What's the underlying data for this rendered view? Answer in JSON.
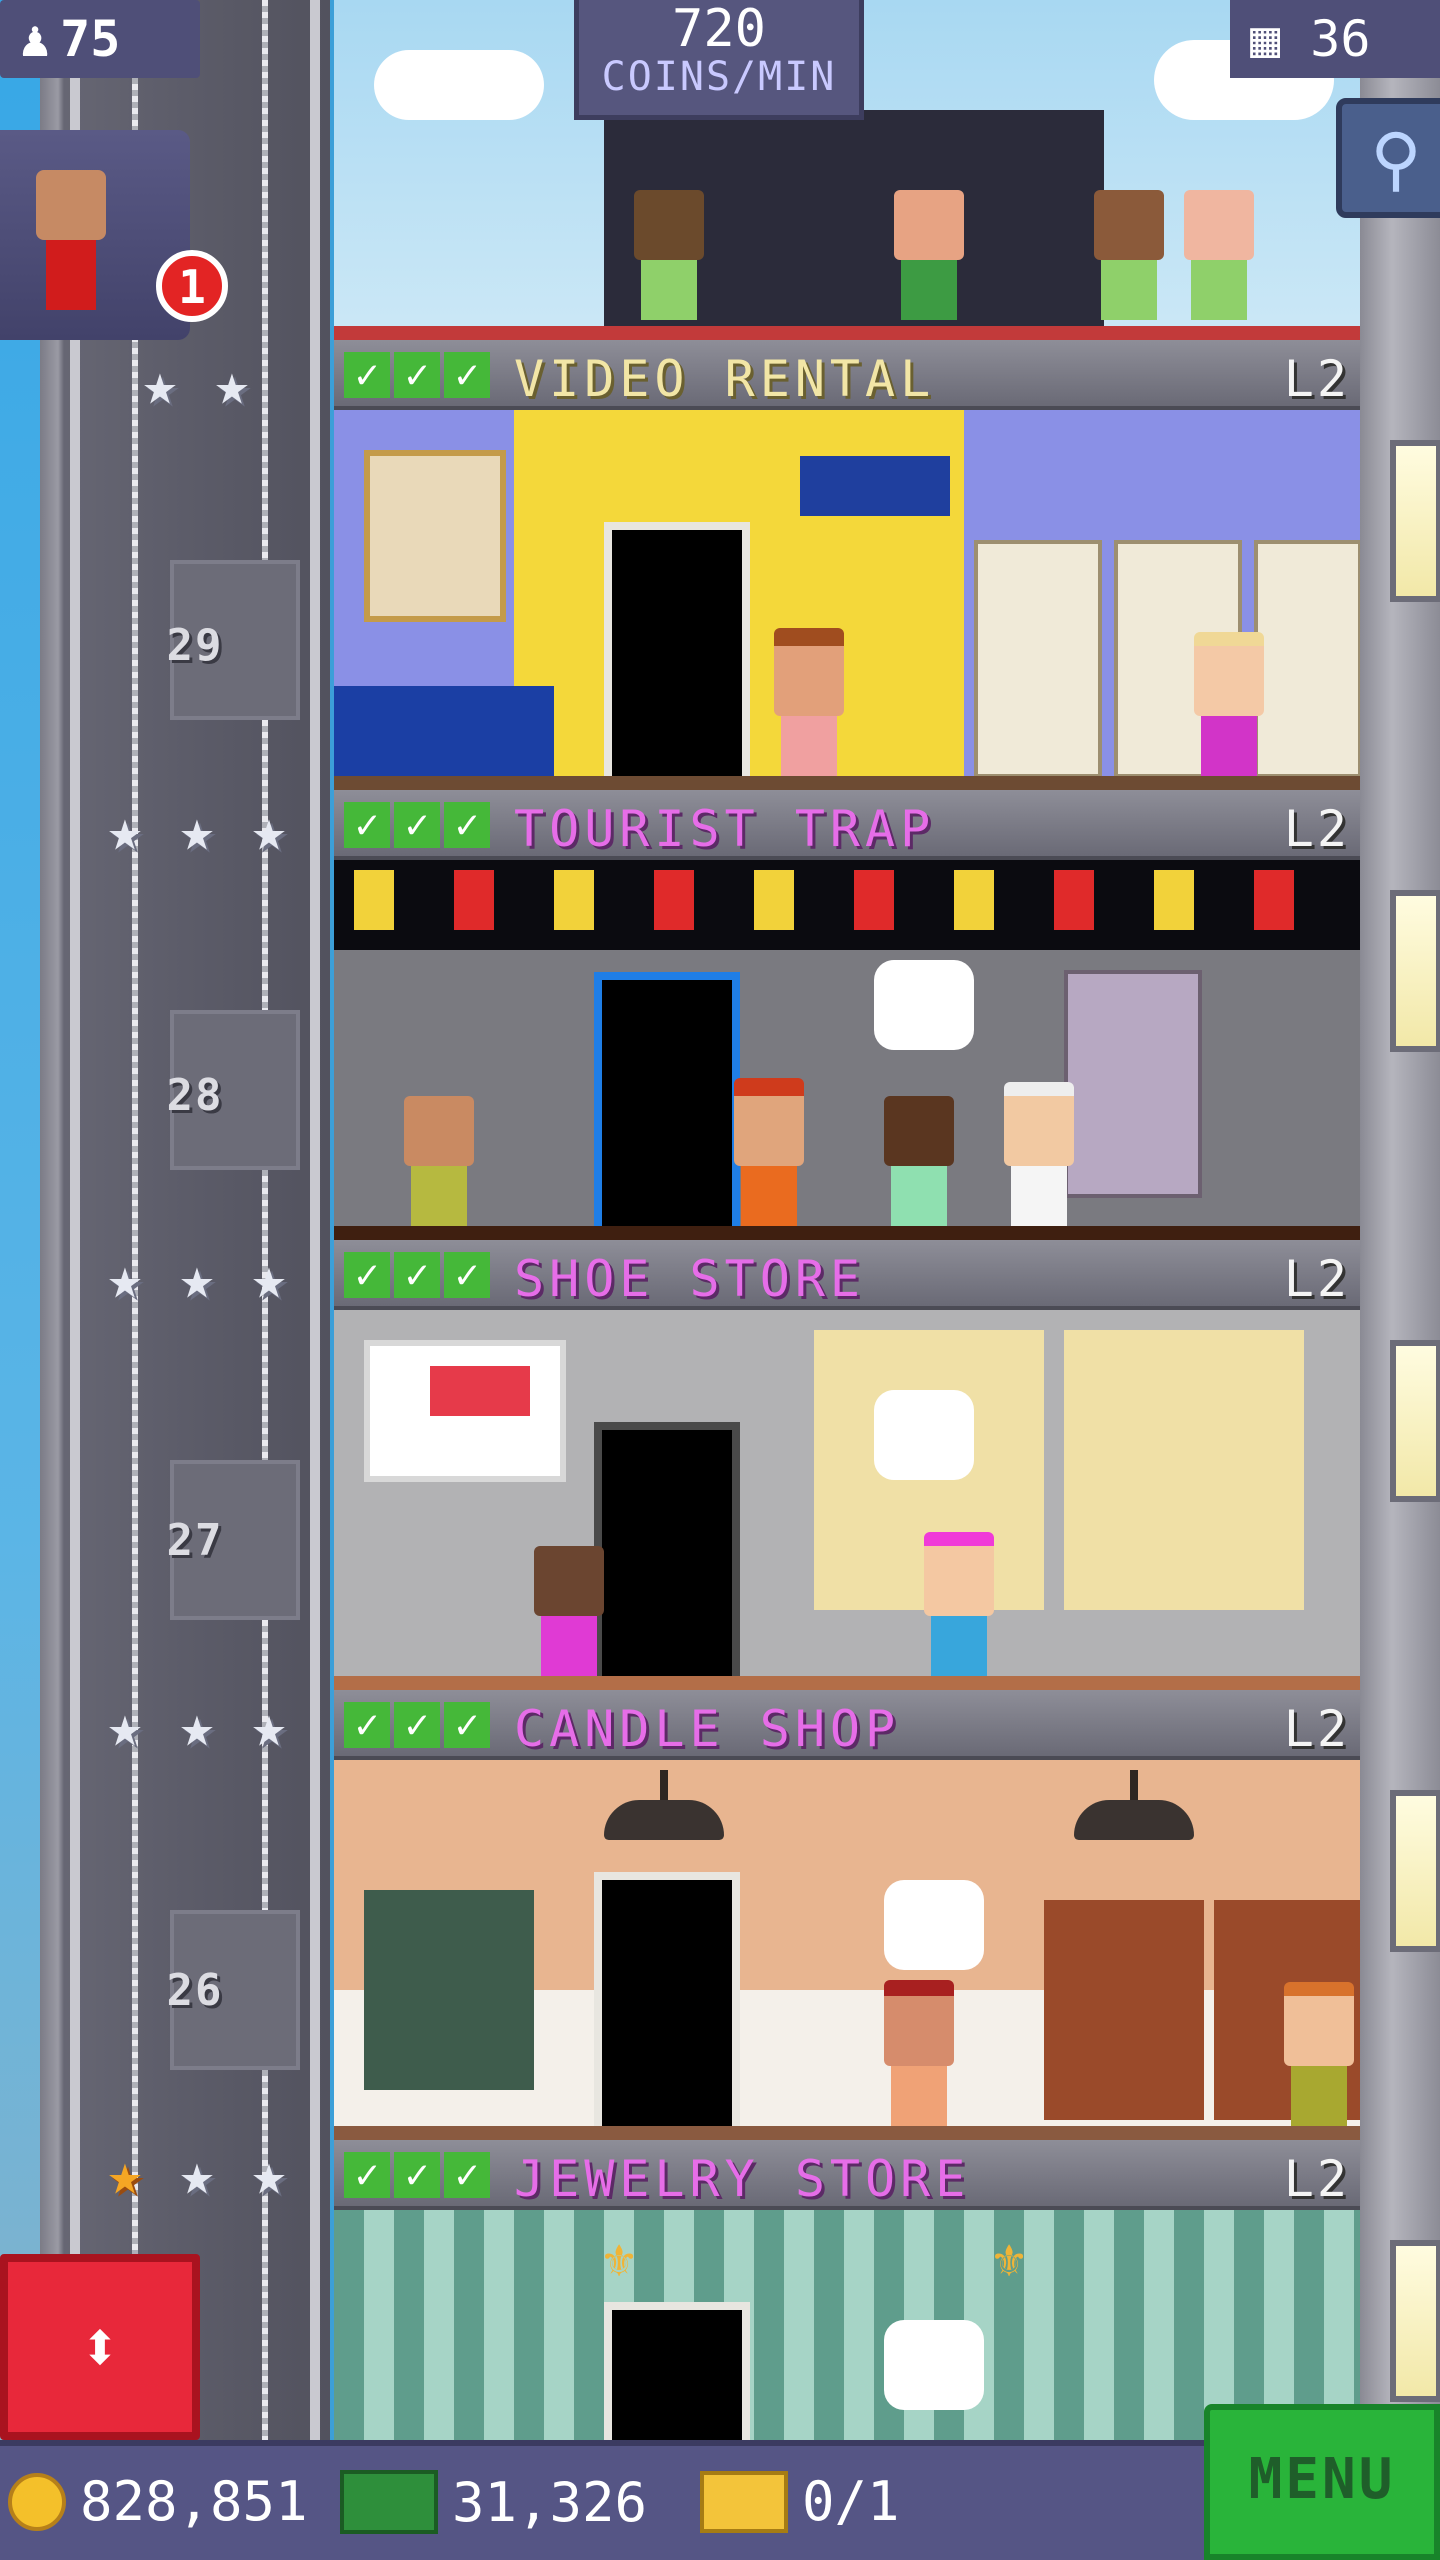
{
  "hud": {
    "population": "75",
    "coins_per_min_value": "720",
    "coins_per_min_unit": "COINS/MIN",
    "floor_count": "36",
    "notification_count": "1"
  },
  "floors": [
    {
      "name": "VIDEO RENTAL",
      "level": "L2",
      "number": "29",
      "stars_filled": 0,
      "stars_total": 2
    },
    {
      "name": "TOURIST TRAP",
      "level": "L2",
      "number": "28",
      "stars_filled": 0,
      "stars_total": 3
    },
    {
      "name": "SHOE STORE",
      "level": "L2",
      "number": "27",
      "stars_filled": 0,
      "stars_total": 3
    },
    {
      "name": "CANDLE SHOP",
      "level": "L2",
      "number": "26",
      "stars_filled": 0,
      "stars_total": 3
    },
    {
      "name": "JEWELRY STORE",
      "level": "L2",
      "number": "",
      "stars_filled": 1,
      "stars_total": 3
    }
  ],
  "bottom_bar": {
    "coins": "828,851",
    "tower_bux": "31,326",
    "vip": "0/1",
    "menu_label": "MENU"
  },
  "icons": {
    "population": "person-icon",
    "floors": "building-icon",
    "search": "magnifier-icon",
    "elevator": "up-down-arrows-icon"
  },
  "colors": {
    "floor_name_pink": "#e66de8",
    "floor_name_yellow": "#f2e6a6",
    "check_green": "#45b839",
    "menu_green": "#29b43a",
    "elevator_red": "#e8283a",
    "hud_purple": "#555585"
  }
}
